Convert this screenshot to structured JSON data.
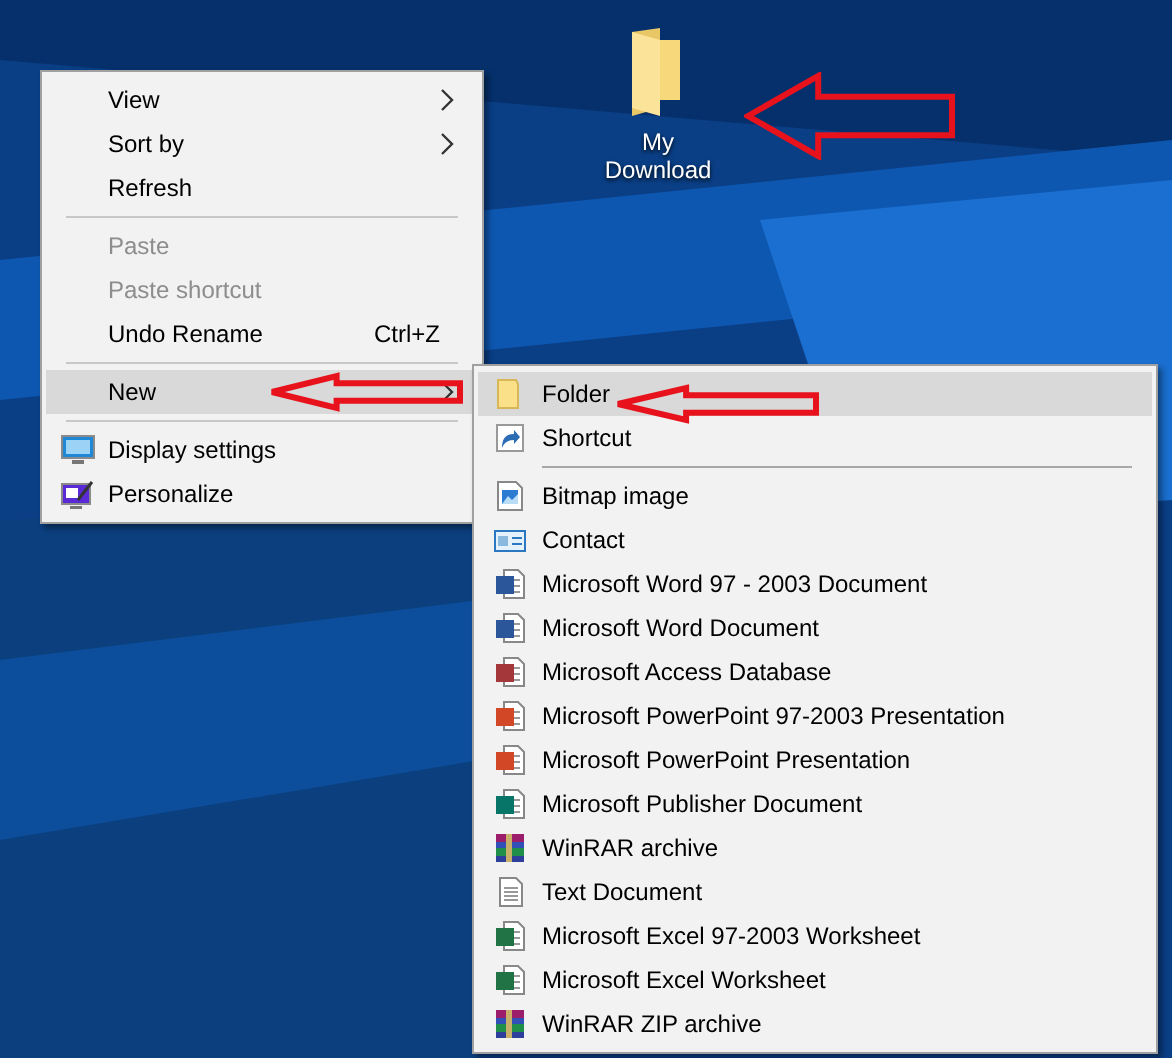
{
  "desktop_icon": {
    "label": "My Download"
  },
  "context_menu": {
    "items": [
      {
        "kind": "plain",
        "label": "View",
        "submenu": true,
        "disabled": false,
        "selected": false
      },
      {
        "kind": "plain",
        "label": "Sort by",
        "submenu": true,
        "disabled": false,
        "selected": false
      },
      {
        "kind": "plain",
        "label": "Refresh",
        "submenu": false,
        "disabled": false,
        "selected": false
      },
      {
        "kind": "separator"
      },
      {
        "kind": "plain",
        "label": "Paste",
        "submenu": false,
        "disabled": true,
        "selected": false
      },
      {
        "kind": "plain",
        "label": "Paste shortcut",
        "submenu": false,
        "disabled": true,
        "selected": false
      },
      {
        "kind": "plain",
        "label": "Undo Rename",
        "shortcut": "Ctrl+Z",
        "submenu": false,
        "disabled": false,
        "selected": false
      },
      {
        "kind": "separator"
      },
      {
        "kind": "plain",
        "label": "New",
        "submenu": true,
        "disabled": false,
        "selected": true
      },
      {
        "kind": "separator"
      },
      {
        "kind": "display",
        "label": "Display settings",
        "submenu": false,
        "disabled": false,
        "selected": false
      },
      {
        "kind": "personalize",
        "label": "Personalize",
        "submenu": false,
        "disabled": false,
        "selected": false
      }
    ]
  },
  "new_submenu": {
    "items": [
      {
        "kind": "folder",
        "label": "Folder",
        "selected": true
      },
      {
        "kind": "shortcut",
        "label": "Shortcut",
        "selected": false
      },
      {
        "kind": "separator"
      },
      {
        "kind": "bitmap",
        "label": "Bitmap image",
        "selected": false
      },
      {
        "kind": "contact",
        "label": "Contact",
        "selected": false
      },
      {
        "kind": "word",
        "label": "Microsoft Word 97 - 2003 Document",
        "selected": false
      },
      {
        "kind": "word",
        "label": "Microsoft Word Document",
        "selected": false
      },
      {
        "kind": "access",
        "label": "Microsoft Access Database",
        "selected": false
      },
      {
        "kind": "powerpoint",
        "label": "Microsoft PowerPoint 97-2003 Presentation",
        "selected": false
      },
      {
        "kind": "powerpoint",
        "label": "Microsoft PowerPoint Presentation",
        "selected": false
      },
      {
        "kind": "publisher",
        "label": "Microsoft Publisher Document",
        "selected": false
      },
      {
        "kind": "archive",
        "label": "WinRAR archive",
        "selected": false
      },
      {
        "kind": "text",
        "label": "Text Document",
        "selected": false
      },
      {
        "kind": "excel",
        "label": "Microsoft Excel 97-2003 Worksheet",
        "selected": false
      },
      {
        "kind": "excel",
        "label": "Microsoft Excel Worksheet",
        "selected": false
      },
      {
        "kind": "archive",
        "label": "WinRAR ZIP archive",
        "selected": false
      }
    ]
  }
}
